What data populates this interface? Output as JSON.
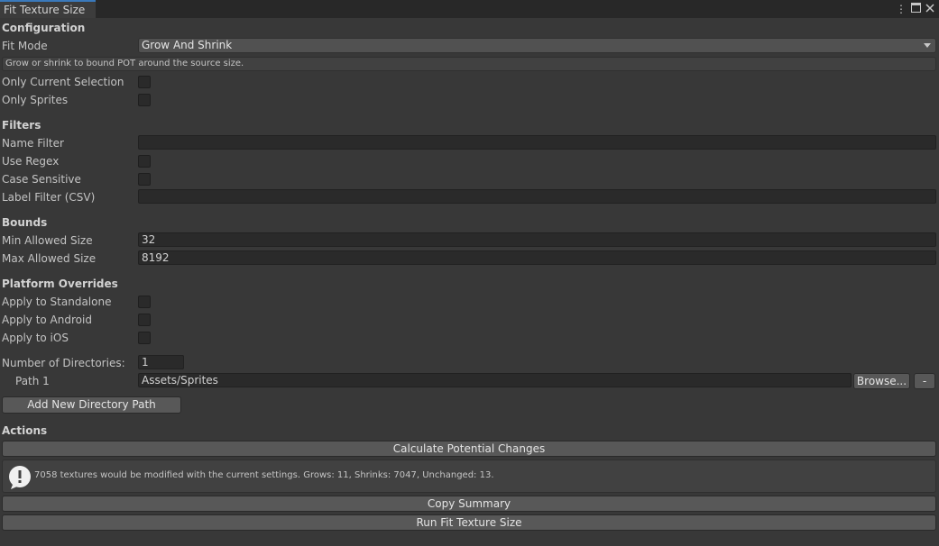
{
  "window": {
    "tab_title": "Fit Texture Size",
    "icons": [
      "kebab-menu-icon",
      "maximize-icon",
      "close-icon"
    ]
  },
  "configuration": {
    "heading": "Configuration",
    "fit_mode_label": "Fit Mode",
    "fit_mode_value": "Grow And Shrink",
    "help_text": "Grow or shrink to bound POT around the source size.",
    "only_current_selection_label": "Only Current Selection",
    "only_sprites_label": "Only Sprites"
  },
  "filters": {
    "heading": "Filters",
    "name_filter_label": "Name Filter",
    "name_filter_value": "",
    "use_regex_label": "Use Regex",
    "case_sensitive_label": "Case Sensitive",
    "label_filter_label": "Label Filter (CSV)",
    "label_filter_value": ""
  },
  "bounds": {
    "heading": "Bounds",
    "min_label": "Min Allowed Size",
    "min_value": "32",
    "max_label": "Max Allowed Size",
    "max_value": "8192"
  },
  "platform": {
    "heading": "Platform Overrides",
    "standalone_label": "Apply to Standalone",
    "android_label": "Apply to Android",
    "ios_label": "Apply to iOS"
  },
  "directories": {
    "count_label": "Number of Directories:",
    "count_value": "1",
    "path1_label": "Path 1",
    "path1_value": "Assets/Sprites",
    "browse_label": "Browse...",
    "remove_label": "-",
    "add_label": "Add New Directory Path"
  },
  "actions": {
    "heading": "Actions",
    "calculate_label": "Calculate Potential Changes",
    "info_message": "7058 textures would be modified with the current settings. Grows: 11, Shrinks: 7047, Unchanged: 13.",
    "copy_summary_label": "Copy Summary",
    "run_label": "Run Fit Texture Size"
  },
  "colors": {
    "accent": "#3a79bb",
    "background": "#383838"
  }
}
